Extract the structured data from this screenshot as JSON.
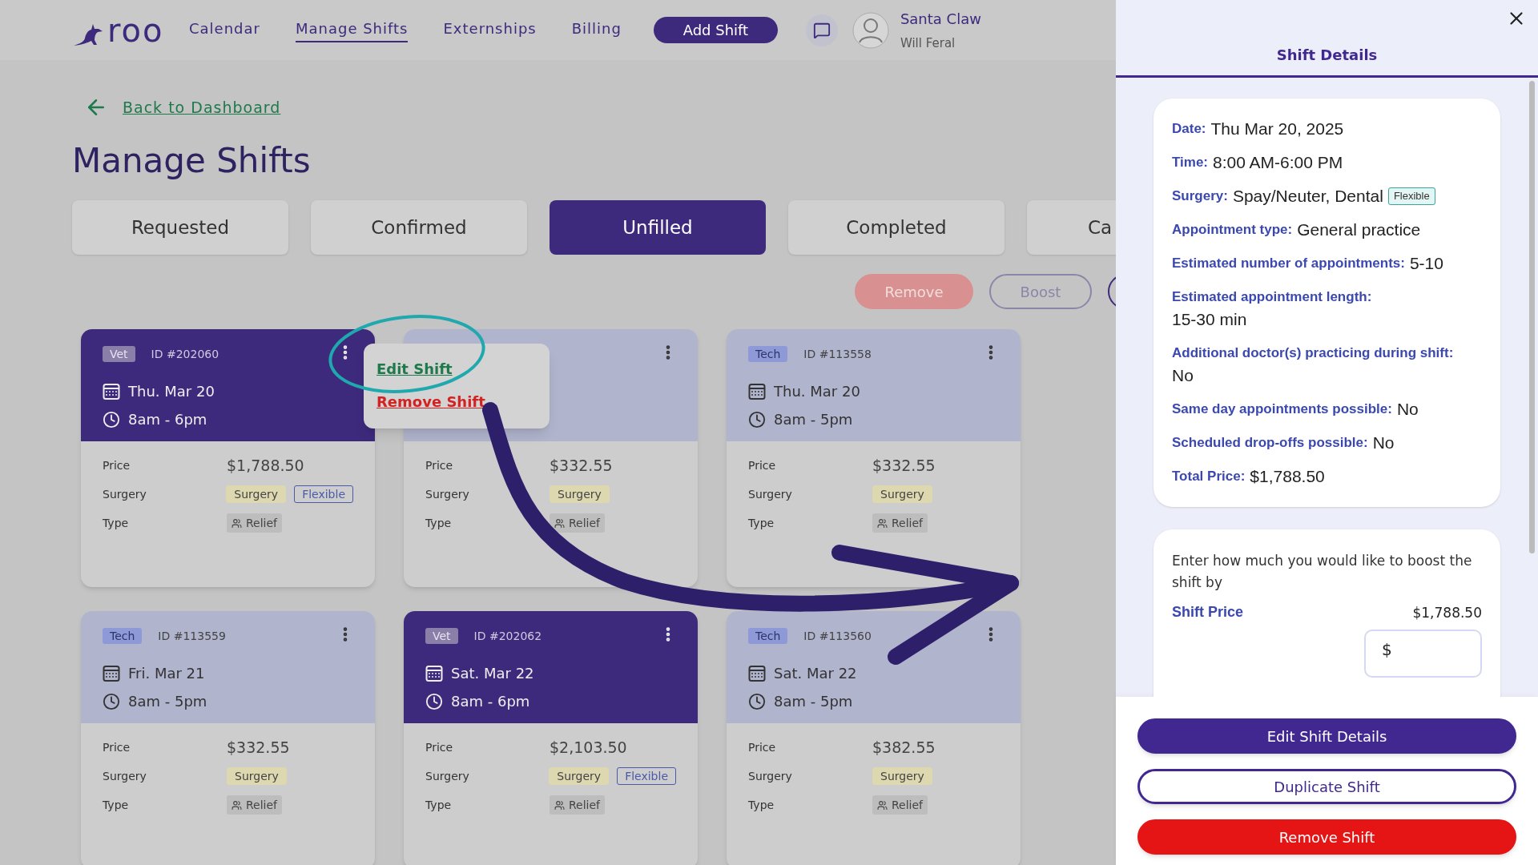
{
  "nav": {
    "logo": "roo",
    "links": [
      {
        "label": "Calendar",
        "selected": false
      },
      {
        "label": "Manage Shifts",
        "selected": true
      },
      {
        "label": "Externships",
        "selected": false
      },
      {
        "label": "Billing",
        "selected": false
      }
    ],
    "add_button": "Add Shift",
    "user": {
      "name": "Santa Claw",
      "subtitle": "Will Feral"
    }
  },
  "back_link": "Back to Dashboard",
  "title": "Manage Shifts",
  "tabs": [
    {
      "label": "Requested",
      "selected": false
    },
    {
      "label": "Confirmed",
      "selected": false
    },
    {
      "label": "Unfilled",
      "selected": true
    },
    {
      "label": "Completed",
      "selected": false
    },
    {
      "label": "Ca",
      "selected": false
    }
  ],
  "actions": [
    {
      "label": "Remove",
      "kind": "danger"
    },
    {
      "label": "Boost",
      "kind": "outline"
    },
    {
      "kind": "round"
    }
  ],
  "cards": [
    {
      "kind": "vet",
      "role": "Vet",
      "id": "ID #202060",
      "date": "Thu. Mar 20",
      "time": "8am - 6pm",
      "menu": [
        {
          "label": "Edit Shift",
          "kind": "edit"
        },
        {
          "label": "Remove Shift",
          "kind": "remove"
        }
      ],
      "rows": [
        {
          "label": "Price",
          "kind": "text",
          "value": "$1,788.50"
        },
        {
          "label": "Surgery",
          "kind": "tags",
          "tags": [
            {
              "label": "Surgery",
              "kind": "surgery"
            },
            {
              "label": "Flexible",
              "kind": "flexible"
            }
          ]
        },
        {
          "label": "Type",
          "kind": "chip",
          "value": "Relief"
        }
      ]
    },
    {
      "kind": "tech",
      "rows": [
        {
          "label": "Price",
          "kind": "text",
          "value": "$332.55"
        },
        {
          "label": "Surgery",
          "kind": "tags",
          "tags": [
            {
              "label": "Surgery",
              "kind": "surgery"
            }
          ]
        },
        {
          "label": "Type",
          "kind": "chip",
          "value": "Relief"
        }
      ]
    },
    {
      "kind": "tech",
      "role": "Tech",
      "id": "ID #113558",
      "date": "Thu. Mar 20",
      "time": "8am - 5pm",
      "rows": [
        {
          "label": "Price",
          "kind": "text",
          "value": "$332.55"
        },
        {
          "label": "Surgery",
          "kind": "tags",
          "tags": [
            {
              "label": "Surgery",
              "kind": "surgery"
            }
          ]
        },
        {
          "label": "Type",
          "kind": "chip",
          "value": "Relief"
        }
      ]
    },
    {
      "kind": "tech",
      "role": "Tech",
      "id": "ID #113559",
      "date": "Fri. Mar 21",
      "time": "8am - 5pm",
      "rows": [
        {
          "label": "Price",
          "kind": "text",
          "value": "$332.55"
        },
        {
          "label": "Surgery",
          "kind": "tags",
          "tags": [
            {
              "label": "Surgery",
              "kind": "surgery"
            }
          ]
        },
        {
          "label": "Type",
          "kind": "chip",
          "value": "Relief"
        }
      ]
    },
    {
      "kind": "vet",
      "role": "Vet",
      "id": "ID #202062",
      "date": "Sat. Mar 22",
      "time": "8am - 6pm",
      "rows": [
        {
          "label": "Price",
          "kind": "text",
          "value": "$2,103.50"
        },
        {
          "label": "Surgery",
          "kind": "tags",
          "tags": [
            {
              "label": "Surgery",
              "kind": "surgery"
            },
            {
              "label": "Flexible",
              "kind": "flexible"
            }
          ]
        },
        {
          "label": "Type",
          "kind": "chip",
          "value": "Relief"
        }
      ]
    },
    {
      "kind": "tech",
      "role": "Tech",
      "id": "ID #113560",
      "date": "Sat. Mar 22",
      "time": "8am - 5pm",
      "rows": [
        {
          "label": "Price",
          "kind": "text",
          "value": "$382.55"
        },
        {
          "label": "Surgery",
          "kind": "tags",
          "tags": [
            {
              "label": "Surgery",
              "kind": "surgery"
            }
          ]
        },
        {
          "label": "Type",
          "kind": "chip",
          "value": "Relief"
        }
      ]
    }
  ],
  "drawer": {
    "tab": "Shift Details",
    "details": [
      {
        "label": "Date:",
        "value": "Thu Mar 20, 2025",
        "kind": "inline"
      },
      {
        "label": "Time:",
        "value": "8:00 AM-6:00 PM",
        "kind": "inline"
      },
      {
        "label": "Surgery:",
        "value": "Spay/Neuter, Dental",
        "badge": "Flexible",
        "kind": "inline"
      },
      {
        "label": "Appointment type:",
        "value": "General practice",
        "kind": "inline"
      },
      {
        "label": "Estimated number of appointments:",
        "value": "5-10",
        "kind": "inline"
      },
      {
        "label": "Estimated appointment length:",
        "value": "15-30 min",
        "kind": "stacked"
      },
      {
        "label": "Additional doctor(s) practicing during shift:",
        "value": "No",
        "kind": "stacked"
      },
      {
        "label": "Same day appointments possible:",
        "value": "No",
        "kind": "inline"
      },
      {
        "label": "Scheduled drop-offs possible:",
        "value": "No",
        "kind": "inline"
      },
      {
        "label": "Total Price:",
        "value": "$1,788.50",
        "kind": "inline"
      }
    ],
    "boost": {
      "prompt": "Enter how much you would like to boost the shift by",
      "price_label": "Shift Price",
      "price": "$1,788.50",
      "prefix": "$"
    },
    "buttons": [
      {
        "label": "Edit Shift Details",
        "kind": "primary"
      },
      {
        "label": "Duplicate Shift",
        "kind": "outline"
      },
      {
        "label": "Remove Shift",
        "kind": "danger"
      }
    ]
  }
}
